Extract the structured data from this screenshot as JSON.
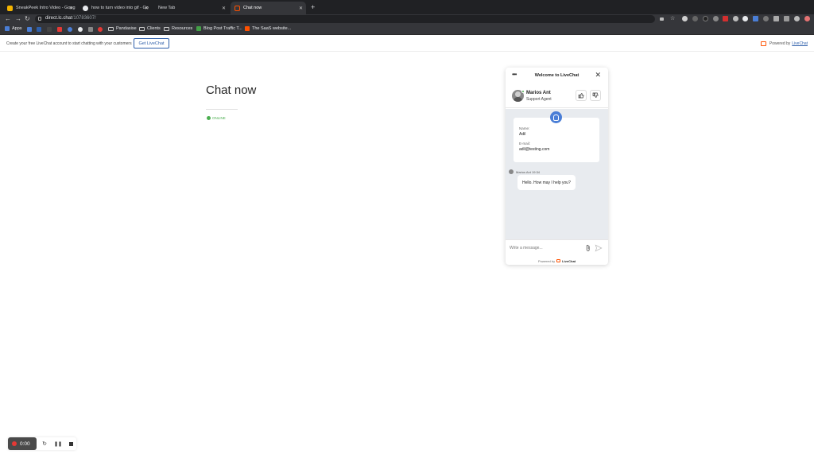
{
  "browser": {
    "tabs": [
      {
        "label": "SneakPeek Intro Video - Goog",
        "active": false,
        "favicon_color": "#f4b400"
      },
      {
        "label": "how to turn video into gif - Go",
        "active": false,
        "favicon_color": "#e8eaed"
      },
      {
        "label": "New Tab",
        "active": false,
        "favicon_color": ""
      },
      {
        "label": "Chat now",
        "active": true,
        "favicon_color": "#ff5100"
      }
    ],
    "address": {
      "host": "direct.lc.chat",
      "path": "/10783607/"
    },
    "bookmarks": {
      "apps_label": "Apps",
      "items": [
        "Pandasise",
        "Clients",
        "Resources",
        "Blog Post Traffic T...",
        "The SaaS website..."
      ]
    }
  },
  "promo": {
    "text": "Create your free LiveChat account to start chatting with your customers",
    "button_label": "Get LiveChat",
    "powered_prefix": "Powered by",
    "powered_link": "LiveChat",
    "brand_color": "#ff5100"
  },
  "page": {
    "title": "Chat now",
    "status": "ONLINE",
    "status_color": "#4caf50"
  },
  "widget": {
    "header_title": "Welcome to LiveChat",
    "agent": {
      "name": "Marios Ant",
      "role": "Support Agent"
    },
    "info": {
      "name_label": "Name:",
      "name_value": "Adil",
      "email_label": "E-mail:",
      "email_value": "adil@testing.com"
    },
    "message": {
      "meta": "Marios Ant 19:34",
      "text": "Hello. How may I help you?"
    },
    "composer": {
      "placeholder": "Write a message..."
    },
    "footer": {
      "prefix": "Powered by",
      "brand": "LiveChat"
    },
    "accent_color": "#4a7ed6"
  },
  "recorder": {
    "time": "0:00",
    "icons": [
      "record-dot-icon",
      "restart-icon",
      "pause-icon",
      "stop-icon"
    ]
  }
}
